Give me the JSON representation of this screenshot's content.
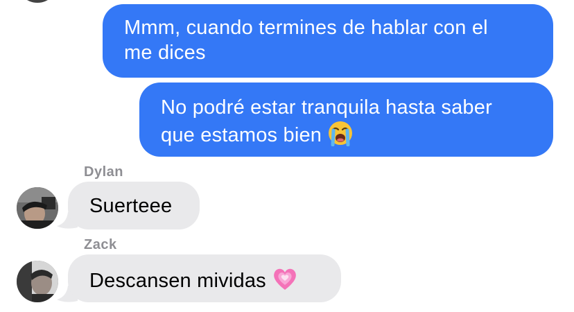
{
  "messages": {
    "outgoing": [
      {
        "line1": "Mmm, cuando termines de hablar con el",
        "line2": "me dices"
      },
      {
        "line1": "No podré estar tranquila hasta saber",
        "line2": "que estamos bien",
        "emoji": "loudly-crying-face"
      }
    ],
    "incoming": [
      {
        "sender": "Dylan",
        "text": "Suerteee"
      },
      {
        "sender": "Zack",
        "text": "Descansen mividas",
        "emoji": "growing-heart"
      }
    ]
  },
  "colors": {
    "outgoing_bubble": "#3478f6",
    "incoming_bubble": "#e9e9eb",
    "sender_label": "#8e8e93"
  }
}
